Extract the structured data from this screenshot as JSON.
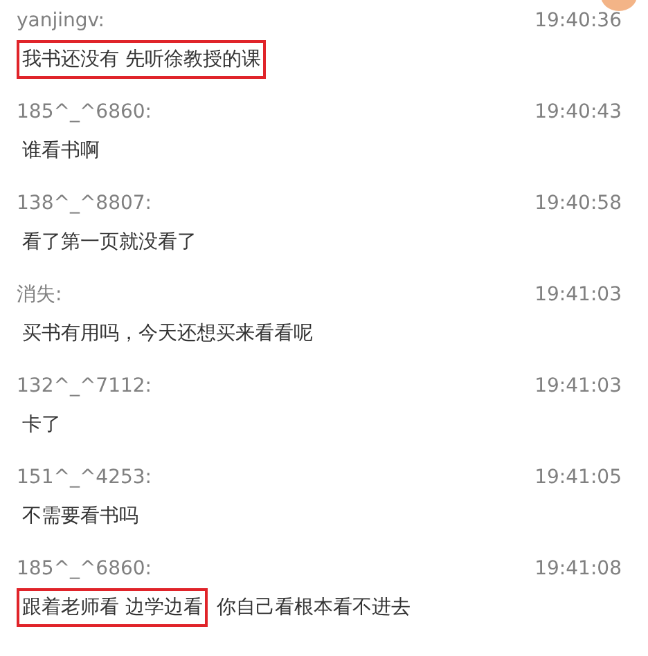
{
  "messages": [
    {
      "sender": "yanjingv:",
      "time": "19:40:36",
      "segments": [
        {
          "text": "我书还没有 先听徐教授的课",
          "highlighted": true
        }
      ]
    },
    {
      "sender": "185^_^6860:",
      "time": "19:40:43",
      "segments": [
        {
          "text": "谁看书啊",
          "highlighted": false
        }
      ]
    },
    {
      "sender": "138^_^8807:",
      "time": "19:40:58",
      "segments": [
        {
          "text": "看了第一页就没看了",
          "highlighted": false
        }
      ]
    },
    {
      "sender": "消失:",
      "time": "19:41:03",
      "segments": [
        {
          "text": "买书有用吗，今天还想买来看看呢",
          "highlighted": false
        }
      ]
    },
    {
      "sender": "132^_^7112:",
      "time": "19:41:03",
      "segments": [
        {
          "text": "卡了",
          "highlighted": false
        }
      ]
    },
    {
      "sender": "151^_^4253:",
      "time": "19:41:05",
      "segments": [
        {
          "text": "不需要看书吗",
          "highlighted": false
        }
      ]
    },
    {
      "sender": "185^_^6860:",
      "time": "19:41:08",
      "segments": [
        {
          "text": "跟着老师看 边学边看",
          "highlighted": true
        },
        {
          "text": "你自己看根本看不进去",
          "highlighted": false
        }
      ]
    }
  ]
}
